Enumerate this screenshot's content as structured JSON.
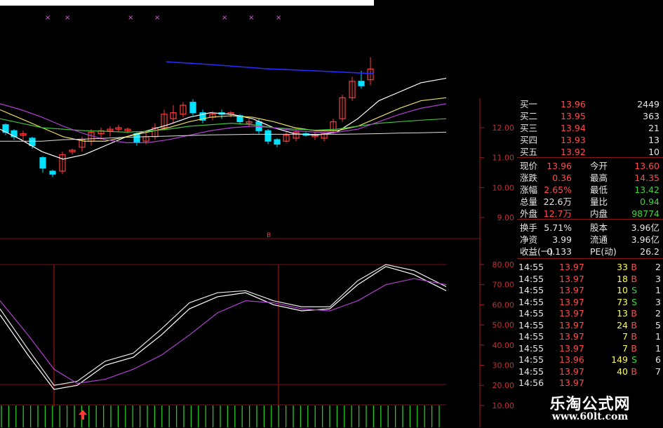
{
  "colors": {
    "up": "#ff3c3c",
    "down": "#00e0ff",
    "grid": "#7a1010",
    "axis": "#a02020",
    "ma_white": "#ffffff",
    "ma_yellow": "#e8e060",
    "ma_green": "#40c040",
    "ma_purple": "#b040d0",
    "ma_blue": "#2a2aff",
    "k": "#ffffff",
    "d": "#e8e8e8",
    "j": "#b040d0",
    "bar_green": "#22cc22"
  },
  "price_axis": {
    "labels": [
      "12.00",
      "11.00",
      "10.00",
      "9.00"
    ],
    "values": [
      12,
      11,
      10,
      9
    ]
  },
  "kdj_axis": {
    "labels": [
      "80.00",
      "70.00",
      "60.00",
      "50.00",
      "40.00",
      "30.00",
      "20.00",
      "10.00"
    ],
    "values": [
      80,
      70,
      60,
      50,
      40,
      30,
      20,
      10
    ]
  },
  "markers": {
    "top_x_label": "× ×",
    "mid_b_label": "B",
    "arrow_icon": "up-arrow-icon"
  },
  "order_book": [
    {
      "label": "买一",
      "price": "13.96",
      "vol": "2449"
    },
    {
      "label": "买二",
      "price": "13.95",
      "vol": "363"
    },
    {
      "label": "买三",
      "price": "13.94",
      "vol": "21"
    },
    {
      "label": "买四",
      "price": "13.93",
      "vol": "13"
    },
    {
      "label": "买五",
      "price": "13.92",
      "vol": "10"
    }
  ],
  "quote": [
    {
      "l1": "现价",
      "v1": "13.96",
      "c1": "red",
      "l2": "今开",
      "v2": "13.60",
      "c2": "red"
    },
    {
      "l1": "涨跌",
      "v1": "0.36",
      "c1": "red",
      "l2": "最高",
      "v2": "14.35",
      "c2": "red"
    },
    {
      "l1": "涨幅",
      "v1": "2.65%",
      "c1": "red",
      "l2": "最低",
      "v2": "13.42",
      "c2": "green"
    },
    {
      "l1": "总量",
      "v1": "22.6万",
      "c1": "white",
      "l2": "量比",
      "v2": "0.94",
      "c2": "green"
    },
    {
      "l1": "外盘",
      "v1": "12.7万",
      "c1": "red",
      "l2": "内盘",
      "v2": "98774",
      "c2": "green"
    }
  ],
  "fundamentals": [
    {
      "l1": "换手",
      "v1": "5.71%",
      "l2": "股本",
      "v2": "3.96亿"
    },
    {
      "l1": "净资",
      "v1": "3.99",
      "l2": "流通",
      "v2": "3.96亿"
    },
    {
      "l1": "收益(一)",
      "v1": "0.133",
      "l2": "PE(动)",
      "v2": "26.2"
    }
  ],
  "ticks": [
    {
      "time": "14:55",
      "price": "13.97",
      "vol": "33",
      "side": "B",
      "n": "2"
    },
    {
      "time": "14:55",
      "price": "13.97",
      "vol": "18",
      "side": "B",
      "n": "3"
    },
    {
      "time": "14:55",
      "price": "13.97",
      "vol": "10",
      "side": "S",
      "n": "1"
    },
    {
      "time": "14:55",
      "price": "13.97",
      "vol": "73",
      "side": "S",
      "n": "3"
    },
    {
      "time": "14:55",
      "price": "13.97",
      "vol": "13",
      "side": "B",
      "n": "2"
    },
    {
      "time": "14:55",
      "price": "13.97",
      "vol": "24",
      "side": "B",
      "n": "5"
    },
    {
      "time": "14:55",
      "price": "13.97",
      "vol": "7",
      "side": "B",
      "n": "1"
    },
    {
      "time": "14:55",
      "price": "13.97",
      "vol": "7",
      "side": "B",
      "n": "1"
    },
    {
      "time": "14:55",
      "price": "13.96",
      "vol": "149",
      "side": "S",
      "n": "6"
    },
    {
      "time": "14:55",
      "price": "13.97",
      "vol": "40",
      "side": "B",
      "n": "7"
    },
    {
      "time": "14:56",
      "price": "13.97",
      "vol": "",
      "side": "",
      "n": ""
    }
  ],
  "watermark": {
    "title": "乐淘公式网",
    "url": "www.60lt.com"
  }
}
